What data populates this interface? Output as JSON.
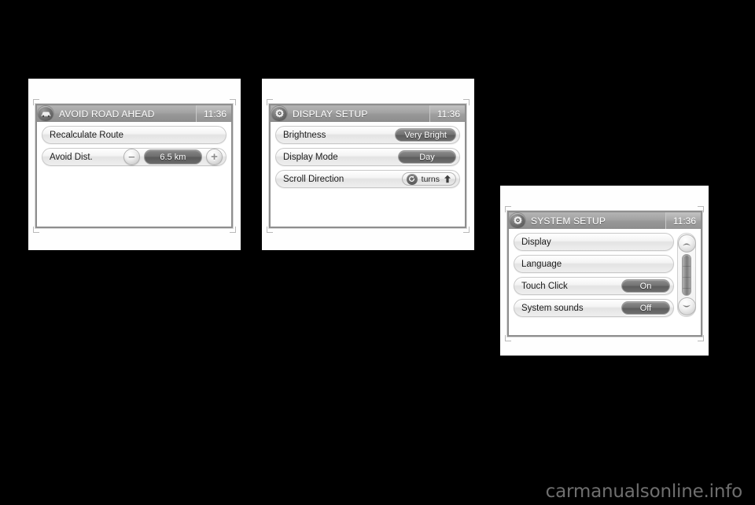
{
  "page": {
    "background_color": "#000000",
    "watermark": "carmanualsonline.info"
  },
  "panels": [
    {
      "id": "avoid-road-ahead",
      "header": {
        "icon": "vehicle-icon",
        "title": "AVOID ROAD AHEAD",
        "time": "11:36"
      },
      "rows": [
        {
          "type": "plain",
          "label": "Recalculate Route"
        },
        {
          "type": "stepper",
          "label": "Avoid Dist.",
          "minus": "–",
          "value": "6.5 km",
          "plus": "+"
        }
      ]
    },
    {
      "id": "display-setup",
      "header": {
        "icon": "gear-icon",
        "title": "DISPLAY SETUP",
        "time": "11:36"
      },
      "rows": [
        {
          "type": "value",
          "label": "Brightness",
          "value": "Very Bright"
        },
        {
          "type": "value",
          "label": "Display Mode",
          "value": "Day"
        },
        {
          "type": "scroll-direction",
          "label": "Scroll Direction",
          "rotate_icon": "rotate-ccw-icon",
          "value": "turns",
          "arrow_icon": "arrow-up-icon"
        }
      ]
    },
    {
      "id": "system-setup",
      "header": {
        "icon": "gear-icon",
        "title": "SYSTEM SETUP",
        "time": "11:36"
      },
      "rows": [
        {
          "type": "plain",
          "label": "Display"
        },
        {
          "type": "plain",
          "label": "Language"
        },
        {
          "type": "value",
          "label": "Touch Click",
          "value": "On"
        },
        {
          "type": "value",
          "label": "System sounds",
          "value": "Off"
        }
      ],
      "scrollbar": {
        "up_icon": "chevron-up-icon",
        "down_icon": "chevron-down-icon",
        "thumb": "scroll-thumb"
      }
    }
  ],
  "colors": {
    "titlebar_gray": "#a2a2a2",
    "pill_dark": "#6b6b6b",
    "screen_border": "#8e8e8e",
    "card_white": "#fefefe"
  }
}
